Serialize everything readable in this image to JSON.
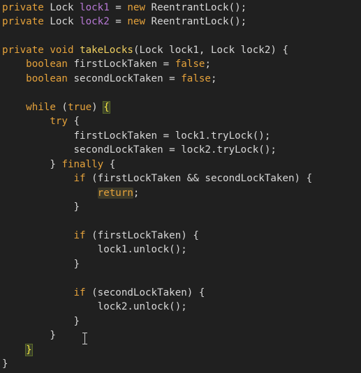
{
  "code": {
    "line1": {
      "kw": "private",
      "type": " Lock ",
      "field": "lock1",
      "rest": " = ",
      "kw2": "new",
      "rest2": " ReentrantLock();"
    },
    "line2": {
      "kw": "private",
      "type": " Lock ",
      "field": "lock2",
      "rest": " = ",
      "kw2": "new",
      "rest2": " ReentrantLock();"
    },
    "line4": {
      "kw": "private",
      "sp": " ",
      "kw2": "void",
      "sp2": " ",
      "fn": "takeLocks",
      "rest": "(Lock lock1, Lock lock2) {"
    },
    "line5": {
      "indent": "    ",
      "kw": "boolean",
      "mid": " firstLockTaken = ",
      "val": "false",
      "end": ";"
    },
    "line6": {
      "indent": "    ",
      "kw": "boolean",
      "mid": " secondLockTaken = ",
      "val": "false",
      "end": ";"
    },
    "line8": {
      "indent": "    ",
      "kw": "while",
      "mid": " (",
      "val": "true",
      "end": ") ",
      "brace": "{"
    },
    "line9": {
      "indent": "        ",
      "kw": "try",
      "end": " {"
    },
    "line10": {
      "indent": "            ",
      "text": "firstLockTaken = lock1.tryLock();"
    },
    "line11": {
      "indent": "            ",
      "text": "secondLockTaken = lock2.tryLock();"
    },
    "line12": {
      "indent": "        ",
      "pre": "} ",
      "kw": "finally",
      "end": " {"
    },
    "line13": {
      "indent": "            ",
      "kw": "if",
      "end": " (firstLockTaken && secondLockTaken) {"
    },
    "line14": {
      "indent": "                ",
      "kw": "return",
      "end": ";"
    },
    "line15": {
      "indent": "            ",
      "text": "}"
    },
    "line17": {
      "indent": "            ",
      "kw": "if",
      "end": " (firstLockTaken) {"
    },
    "line18": {
      "indent": "                ",
      "text": "lock1.unlock();"
    },
    "line19": {
      "indent": "            ",
      "text": "}"
    },
    "line21": {
      "indent": "            ",
      "kw": "if",
      "end": " (secondLockTaken) {"
    },
    "line22": {
      "indent": "                ",
      "text": "lock2.unlock();"
    },
    "line23": {
      "indent": "            ",
      "text": "}"
    },
    "line24": {
      "indent": "        ",
      "text": "}"
    },
    "line25": {
      "indent": "    ",
      "brace": "}"
    },
    "line26": {
      "text": "}"
    }
  },
  "colors": {
    "background": "#202020",
    "keyword": "#e5a23b",
    "field": "#b678d4",
    "method": "#f0d060",
    "text": "#d7d7d7"
  }
}
